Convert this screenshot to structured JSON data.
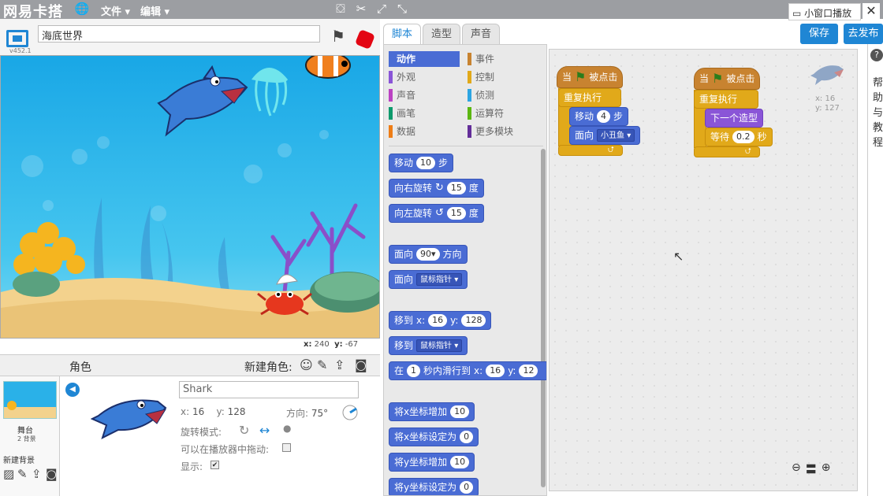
{
  "topbar": {
    "logo": "网易卡搭",
    "menu_file": "文件",
    "menu_edit": "编辑",
    "mini_window": "小窗口播放",
    "close": "✕"
  },
  "stage_header": {
    "version": "v452.1",
    "project_title": "海底世界"
  },
  "stage": {
    "mouse_x": "240",
    "mouse_y": "-67",
    "x_label": "x:",
    "y_label": "y:"
  },
  "sprites_header": {
    "role_label": "角色",
    "new_role": "新建角色:"
  },
  "stage_pane": {
    "name": "舞台",
    "bg_count": "2 背景",
    "new_bg": "新建背景"
  },
  "sprite": {
    "name": "Shark",
    "x_label": "x:",
    "x": "16",
    "y_label": "y:",
    "y": "128",
    "direction_label": "方向:",
    "direction": "75°",
    "rotation_mode_label": "旋转模式:",
    "draggable_label": "可以在播放器中拖动:",
    "show_label": "显示:",
    "show_check": "✔"
  },
  "tabs": {
    "scripts": "脚本",
    "costumes": "造型",
    "sounds": "声音"
  },
  "buttons": {
    "save": "保存",
    "publish": "去发布"
  },
  "categories": [
    {
      "label": "动作",
      "color": "#4a6cd4"
    },
    {
      "label": "事件",
      "color": "#c88330"
    },
    {
      "label": "外观",
      "color": "#8a55d7"
    },
    {
      "label": "控制",
      "color": "#e1a91a"
    },
    {
      "label": "声音",
      "color": "#bb42c3"
    },
    {
      "label": "侦测",
      "color": "#2ca5e2"
    },
    {
      "label": "画笔",
      "color": "#0e9a6c"
    },
    {
      "label": "运算符",
      "color": "#5cb712"
    },
    {
      "label": "数据",
      "color": "#ee7d16"
    },
    {
      "label": "更多模块",
      "color": "#632d99"
    }
  ],
  "palette_blocks": {
    "move": "移动",
    "move_n": "10",
    "steps": "步",
    "turn_right": "向右旋转",
    "turn_right_n": "15",
    "deg": "度",
    "turn_left": "向左旋转",
    "turn_left_n": "15",
    "point_dir": "面向",
    "point_dir_n": "90▾",
    "direction": "方向",
    "point_towards": "面向",
    "mouse_pointer": "鼠标指针",
    "goto_xy": "移到",
    "x": "x:",
    "x_n": "16",
    "y": "y:",
    "y_n": "128",
    "goto": "移到",
    "goto_target": "鼠标指针",
    "glide": "在",
    "glide_n": "1",
    "glide_txt": "秒内滑行到",
    "glide_x": "16",
    "glide_y": "12",
    "change_x": "将x坐标增加",
    "change_x_n": "10",
    "set_x": "将x坐标设定为",
    "set_x_n": "0",
    "change_y": "将y坐标增加",
    "change_y_n": "10",
    "set_y": "将y坐标设定为",
    "set_y_n": "0"
  },
  "script1": {
    "when": "当",
    "clicked": "被点击",
    "forever": "重复执行",
    "move": "移动",
    "move_n": "4",
    "steps": "步",
    "point": "面向",
    "target": "小丑鱼"
  },
  "script2": {
    "when": "当",
    "clicked": "被点击",
    "forever": "重复执行",
    "next_costume": "下一个造型",
    "wait": "等待",
    "wait_n": "0.2",
    "sec": "秒"
  },
  "script_area": {
    "x_label": "x:",
    "x": "16",
    "y_label": "y:",
    "y": "127"
  },
  "help": {
    "text": "帮助与教程"
  },
  "colors": {
    "accent": "#1f86d4",
    "motion": "#4a6cd4",
    "control": "#e1a91a",
    "looks": "#8a55d7",
    "stop": "#e30613"
  }
}
